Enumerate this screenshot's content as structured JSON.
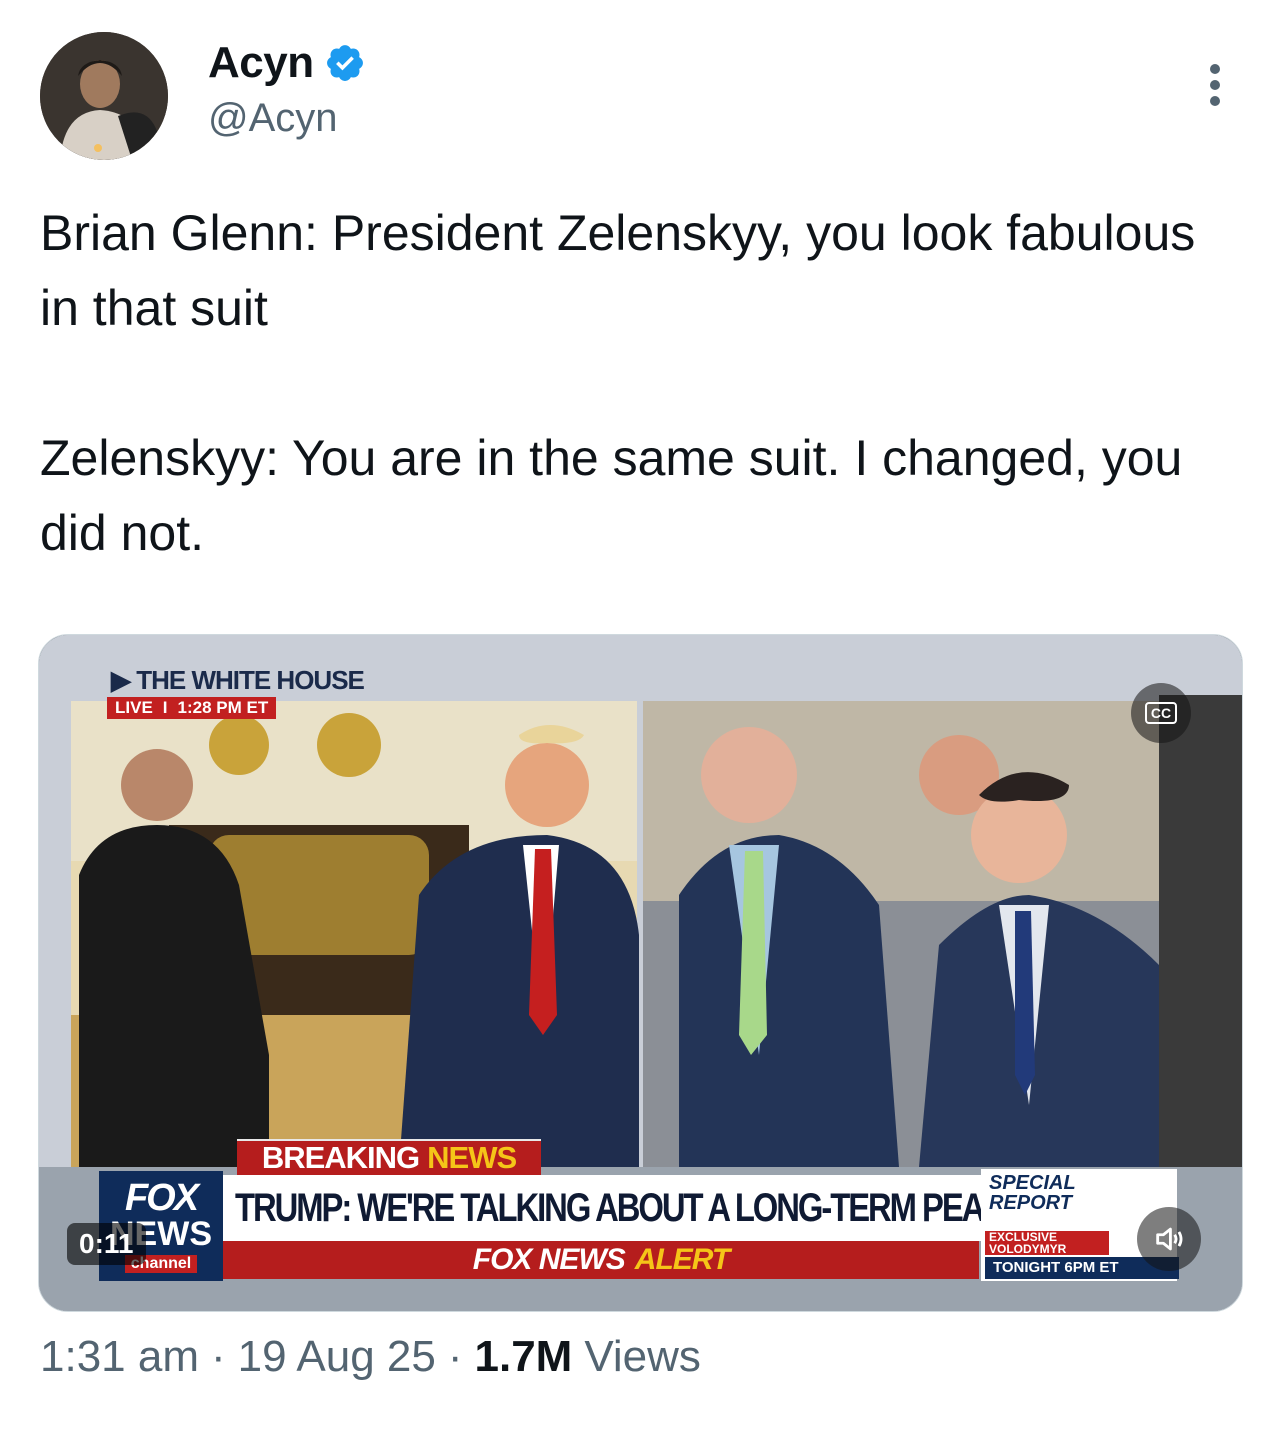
{
  "author": {
    "display_name": "Acyn",
    "handle": "@Acyn",
    "verified": true
  },
  "tweet": {
    "text": "Brian Glenn: President Zelenskyy, you look fabulous in that suit\n\nZelenskyy: You are in the same suit. I changed, you did not."
  },
  "media": {
    "type": "video",
    "timestamp": "0:11",
    "overlays": {
      "location_label": "THE WHITE HOUSE",
      "live_label": "LIVE",
      "live_time": "1:28 PM ET",
      "breaking_a": "BREAKING",
      "breaking_b": "NEWS",
      "network_line1": "FOX",
      "network_line2": "NEWS",
      "network_line3": "channel",
      "headline": "TRUMP: WE'RE TALKING ABOUT A LONG-TERM PEACE DEAL",
      "alert_a": "FOX NEWS",
      "alert_b": "ALERT",
      "special_title_1": "SPECIAL",
      "special_title_2": "REPORT",
      "special_exclusive": "EXCLUSIVE",
      "special_name": "VOLODYMYR ZELENS",
      "special_time": "TONIGHT 6PM ET"
    },
    "cc_label": "CC"
  },
  "meta": {
    "time": "1:31 am",
    "date": "19 Aug 25",
    "views_count": "1.7M",
    "views_label": "Views",
    "separator": "·"
  },
  "colors": {
    "verified_blue": "#1d9bf0",
    "secondary_text": "#536471",
    "primary_text": "#0f1419",
    "fox_red": "#b51d1d",
    "fox_navy": "#0f2c5a",
    "fox_yellow": "#f5c518"
  }
}
